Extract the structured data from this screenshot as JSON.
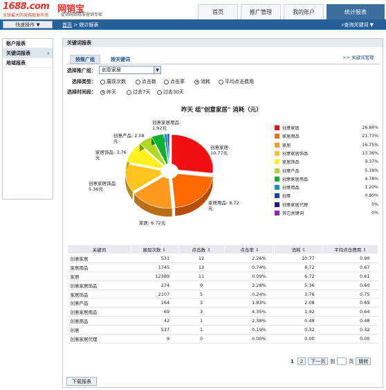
{
  "logo": {
    "brand1": "1688.com",
    "tagline1": "全球最大的采购批发市场",
    "brand2": "网销宝",
    "tagline2": "促销网络精准营销专家"
  },
  "nav": {
    "tabs": [
      "首页",
      "推广管理",
      "我的账户",
      "统计报表"
    ],
    "active": 3
  },
  "bar": {
    "quick": "快速操作 ▼",
    "crumb_home": "首页",
    "crumb_sep": " > ",
    "crumb_current": "统计报表",
    "search": "⌕查询关键词 ▼"
  },
  "sidebar": {
    "items": [
      {
        "label": "账户报表",
        "arrow": ""
      },
      {
        "label": "关键词报表",
        "arrow": "›"
      },
      {
        "label": "地域报表",
        "arrow": ""
      }
    ]
  },
  "main": {
    "title": "关键词报表",
    "tab_group": "按推广组",
    "tab_keyword": "按关键词",
    "kw_manage": ">> 关键词管理",
    "label_group": "选择推广组：",
    "group_value": "创意家居",
    "label_type": "选择类型：",
    "types": [
      "展现次数",
      "点击数",
      "点击率",
      "消耗",
      "平均点击费用"
    ],
    "type_selected": 3,
    "label_period": "选择时间段：",
    "periods": [
      "昨天",
      "过去7天",
      "过去30天"
    ],
    "period_selected": 0
  },
  "chart_data": {
    "type": "pie",
    "title": "昨天 组\"创意家居\" 消耗（元）",
    "slices": [
      {
        "name": "创意家居",
        "value": 10.77,
        "percent": "26.84%",
        "color": "#f01010"
      },
      {
        "name": "家居用品",
        "value": 8.72,
        "percent": "21.73%",
        "color": "#ff6a00"
      },
      {
        "name": "家居",
        "value": 6.72,
        "percent": "16.75%",
        "color": "#ff9a1e"
      },
      {
        "name": "创意家居饰品",
        "value": 5.36,
        "percent": "13.36%",
        "color": "#ffc41e"
      },
      {
        "name": "家居饰品",
        "value": 3.76,
        "percent": "9.37%",
        "color": "#fff01e"
      },
      {
        "name": "创意产品",
        "value": 2.08,
        "percent": "5.18%",
        "color": "#b0d820"
      },
      {
        "name": "创意家居用品",
        "value": 1.92,
        "percent": "4.78%",
        "color": "#10b030"
      },
      {
        "name": "创意用品",
        "value": 0.48,
        "percent": "1.20%",
        "color": "#1a90c8"
      },
      {
        "name": "创意",
        "value": 0.32,
        "percent": "0.80%",
        "color": "#1040c8"
      },
      {
        "name": "创意家居代理",
        "value": 0,
        "percent": "0%",
        "color": "#1a1aa0"
      },
      {
        "name": "其它关键词",
        "value": 0,
        "percent": "0%",
        "color": "#8a20c8"
      }
    ],
    "slice_labels": [
      {
        "line1": "创意家居:",
        "line2": "10.77元"
      },
      {
        "line1": "家居用品: 8.72",
        "line2": "元"
      },
      {
        "line1": "家居: 6.72元",
        "line2": ""
      },
      {
        "line1": "创意家居饰品:",
        "line2": "5.36元"
      },
      {
        "line1": "家居饰品: 3.76",
        "line2": "元"
      },
      {
        "line1": "创意产品: 2.08",
        "line2": "元"
      },
      {
        "line1": "创意家居用品:",
        "line2": "1.92元"
      }
    ]
  },
  "table": {
    "headers": [
      "关键词",
      "展现次数 ⇩",
      "点击数 ⇩",
      "点击率 ⇩",
      "消耗 ⇩",
      "平均点击费用 ⇩"
    ],
    "rows": [
      [
        "创意家居",
        "531",
        "12",
        "2.26%",
        "10.77",
        "0.90"
      ],
      [
        "家居用品",
        "1745",
        "13",
        "0.74%",
        "8.72",
        "0.67"
      ],
      [
        "家居",
        "12389",
        "11",
        "0.09%",
        "6.72",
        "0.61"
      ],
      [
        "创意家居饰品",
        "274",
        "9",
        "3.28%",
        "5.36",
        "0.60"
      ],
      [
        "家居饰品",
        "2107",
        "5",
        "0.24%",
        "3.76",
        "0.75"
      ],
      [
        "创意产品",
        "164",
        "3",
        "1.83%",
        "2.08",
        "0.69"
      ],
      [
        "创意家居用品",
        "69",
        "3",
        "4.35%",
        "1.92",
        "0.64"
      ],
      [
        "创意用品",
        "42",
        "1",
        "2.38%",
        "0.48",
        "0.48"
      ],
      [
        "创意",
        "537",
        "1",
        "0.19%",
        "0.32",
        "0.32"
      ],
      [
        "创意家居代理",
        "9",
        "0",
        "0.00%",
        "0.00",
        "0.00"
      ]
    ]
  },
  "pager": {
    "p1": "1",
    "p2": "2",
    "next": "下一页",
    "goto": "到",
    "unit": "页",
    "jump": "跳转"
  },
  "download": "下载报表"
}
